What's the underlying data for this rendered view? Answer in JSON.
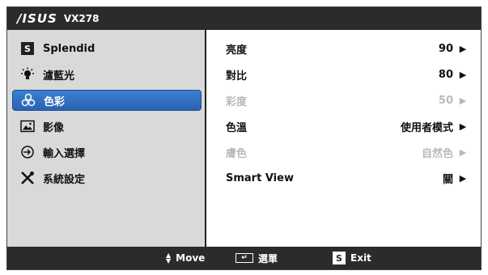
{
  "title": {
    "brand": "/ISUS",
    "model": "VX278"
  },
  "sidebar": {
    "items": [
      {
        "label": "Splendid",
        "icon": "splendid-s-icon"
      },
      {
        "label": "濾藍光",
        "icon": "bulb-icon"
      },
      {
        "label": "色彩",
        "icon": "color-icon",
        "active": true
      },
      {
        "label": "影像",
        "icon": "image-icon"
      },
      {
        "label": "輸入選擇",
        "icon": "input-icon"
      },
      {
        "label": "系統設定",
        "icon": "tools-icon"
      }
    ]
  },
  "settings": [
    {
      "label": "亮度",
      "value": "90",
      "enabled": true
    },
    {
      "label": "對比",
      "value": "80",
      "enabled": true
    },
    {
      "label": "彩度",
      "value": "50",
      "enabled": false
    },
    {
      "label": "色溫",
      "value": "使用者模式",
      "enabled": true
    },
    {
      "label": "膚色",
      "value": "自然色",
      "enabled": false
    },
    {
      "label": "Smart View",
      "value": "關",
      "enabled": true
    }
  ],
  "footer": {
    "move_label": "Move",
    "menu_label": "選單",
    "exit_label": "Exit",
    "exit_key": "S"
  },
  "colors": {
    "accent": "#2a62b0",
    "bar": "#2b2b2b",
    "disabled": "#b9b9b9"
  }
}
